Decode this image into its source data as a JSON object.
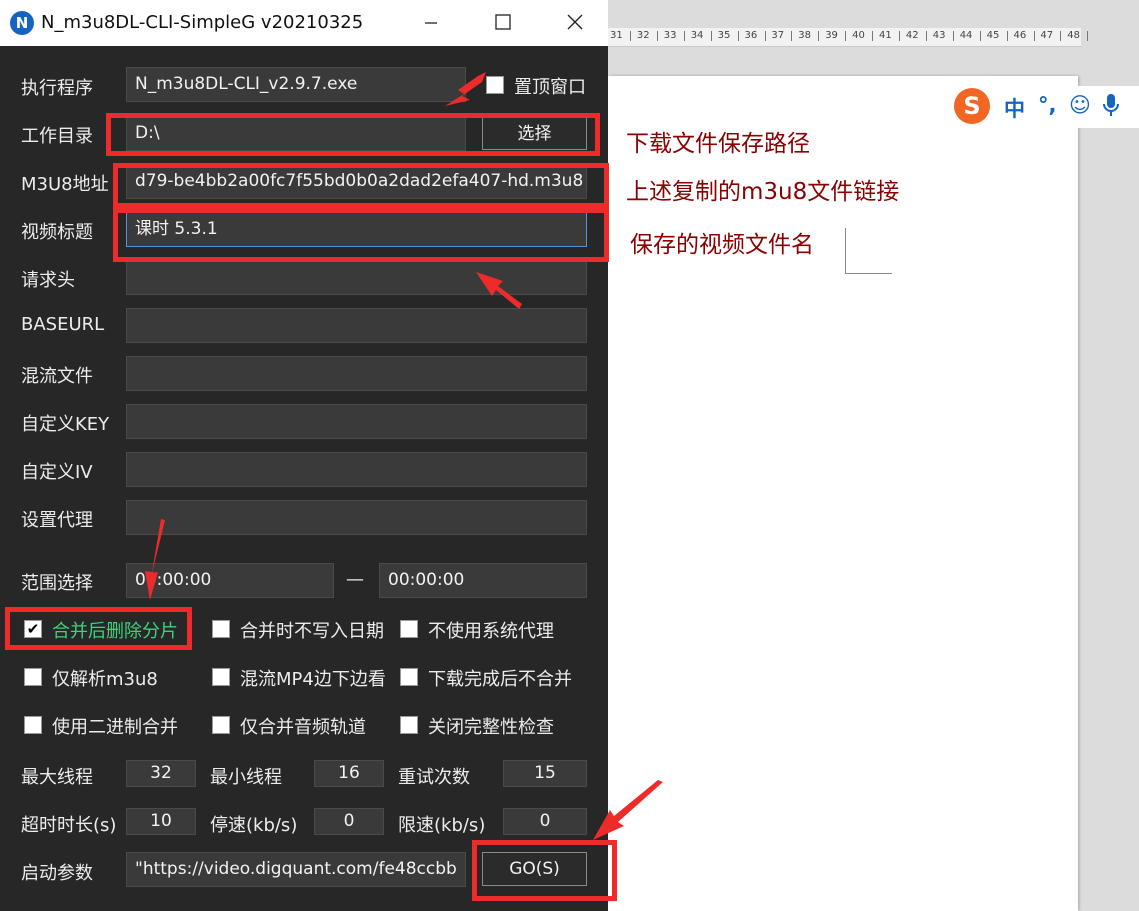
{
  "window": {
    "title": "N_m3u8DL-CLI-SimpleG v20210325",
    "logo_letter": "N",
    "minimize": "—",
    "maximize": "☐",
    "close": "✕"
  },
  "ruler_ticks": [
    "31",
    "32",
    "33",
    "34",
    "35",
    "36",
    "37",
    "38",
    "39",
    "40",
    "41",
    "42",
    "43",
    "44",
    "45",
    "46",
    "47",
    "48"
  ],
  "annotations": {
    "save_path": "下载文件保存路径",
    "m3u8_link": "上述复制的m3u8文件链接",
    "video_name": "保存的视频文件名"
  },
  "ime": {
    "logo": "S",
    "mode": "中",
    "punct": "°,",
    "emoji": "☺",
    "mic": "🎤"
  },
  "form": {
    "exe_label": "执行程序",
    "exe_value": "N_m3u8DL-CLI_v2.9.7.exe",
    "topmost_label": "置顶窗口",
    "workdir_label": "工作目录",
    "workdir_value": "D:\\",
    "choose_button": "选择",
    "m3u8_label": "M3U8地址",
    "m3u8_value": "d79-be4bb2a00fc7f55bd0b0a2dad2efa407-hd.m3u8",
    "title_label": "视频标题",
    "title_value": "课时 5.3.1",
    "headers_label": "请求头",
    "headers_value": "",
    "baseurl_label": "BASEURL",
    "baseurl_value": "",
    "mux_label": "混流文件",
    "mux_value": "",
    "key_label": "自定义KEY",
    "key_value": "",
    "iv_label": "自定义IV",
    "iv_value": "",
    "proxy_label": "设置代理",
    "proxy_value": "",
    "range_label": "范围选择",
    "range_start": "00:00:00",
    "range_dash": "—",
    "range_end": "00:00:00"
  },
  "checkboxes": [
    {
      "label": "合并后删除分片",
      "checked": "✔"
    },
    {
      "label": "合并时不写入日期",
      "checked": ""
    },
    {
      "label": "不使用系统代理",
      "checked": ""
    },
    {
      "label": "仅解析m3u8",
      "checked": ""
    },
    {
      "label": "混流MP4边下边看",
      "checked": ""
    },
    {
      "label": "下载完成后不合并",
      "checked": ""
    },
    {
      "label": "使用二进制合并",
      "checked": ""
    },
    {
      "label": "仅合并音频轨道",
      "checked": ""
    },
    {
      "label": "关闭完整性检查",
      "checked": ""
    }
  ],
  "numbers": {
    "max_threads_label": "最大线程",
    "max_threads": "32",
    "min_threads_label": "最小线程",
    "min_threads": "16",
    "retry_label": "重试次数",
    "retry": "15",
    "timeout_label": "超时时长(s)",
    "timeout": "10",
    "stop_speed_label": "停速(kb/s)",
    "stop_speed": "0",
    "limit_speed_label": "限速(kb/s)",
    "limit_speed": "0"
  },
  "launch": {
    "label": "启动参数",
    "value": "\"https://video.digquant.com/fe48ccbb",
    "go_button": "GO(S)"
  },
  "colors": {
    "annotation": "#8b0000",
    "highlight": "#ee2b2b",
    "app_bg": "#272727",
    "checked_label": "#3fd27a"
  }
}
